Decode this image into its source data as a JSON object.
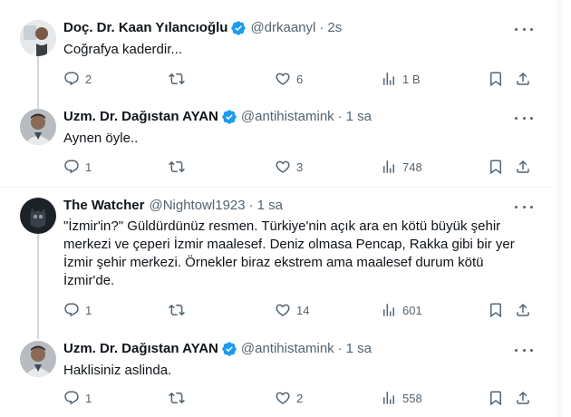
{
  "colors": {
    "accent": "#1d9bf0",
    "text": "#0f1419",
    "secondary": "#536471",
    "line": "#cfd9de"
  },
  "tweets": [
    {
      "name": "Doç. Dr. Kaan Yılancıoğlu",
      "handle": "@drkaanyl",
      "separator": "·",
      "time": "2s",
      "lines": [
        "Coğrafya kaderdir..."
      ],
      "replies": "2",
      "retweets": "",
      "likes": "6",
      "views": "1 B"
    },
    {
      "name": "Uzm. Dr. Dağıstan AYAN",
      "handle": "@antihistamink",
      "separator": "·",
      "time": "1 sa",
      "lines": [
        "Aynen öyle.."
      ],
      "replies": "1",
      "retweets": "",
      "likes": "3",
      "views": "748"
    },
    {
      "name": "The Watcher",
      "handle": "@Nightowl1923",
      "separator": "·",
      "time": "1 sa",
      "lines": [
        "\"İzmir'in?\" Güldürdünüz resmen. Türkiye'nin açık ara en kötü  büyük şehir",
        "merkezi ve çeperi İzmir maalesef. Deniz olmasa Pencap, Rakka gibi bir yer",
        "İzmir şehir merkezi. Örnekler biraz ekstrem ama maalesef durum kötü",
        "İzmir'de."
      ],
      "replies": "1",
      "retweets": "",
      "likes": "14",
      "views": "601"
    },
    {
      "name": "Uzm. Dr. Dağıstan AYAN",
      "handle": "@antihistamink",
      "separator": "·",
      "time": "1 sa",
      "lines": [
        "Haklisiniz aslinda."
      ],
      "replies": "1",
      "retweets": "",
      "likes": "2",
      "views": "558"
    }
  ]
}
